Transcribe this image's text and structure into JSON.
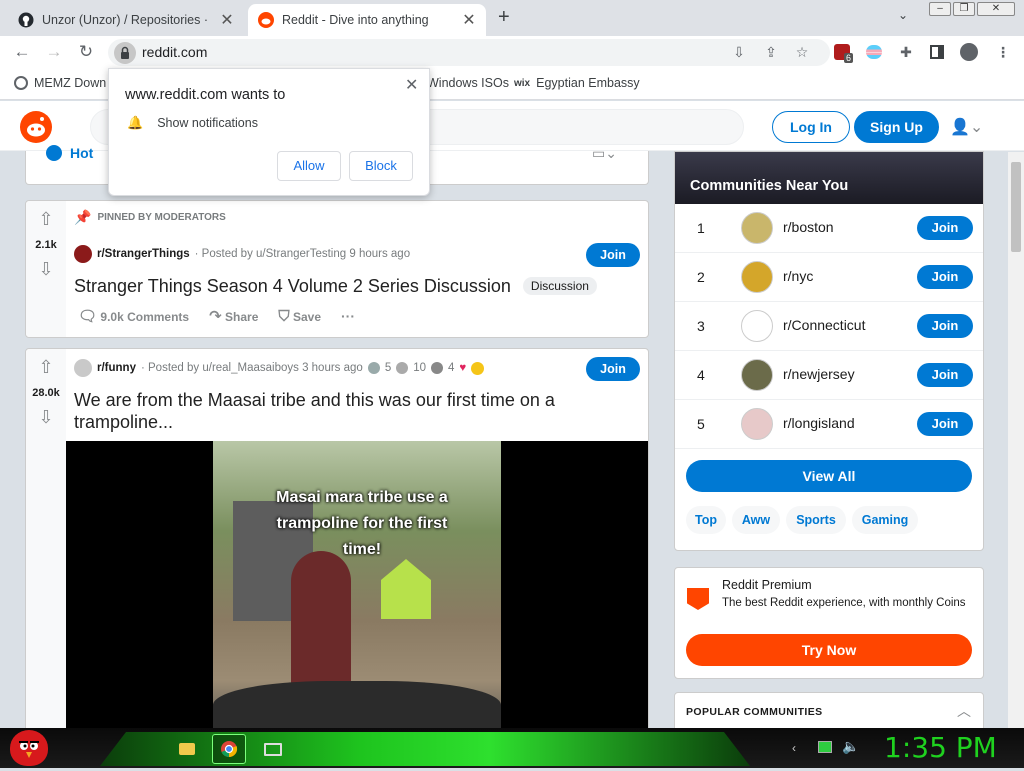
{
  "browser": {
    "tabs": [
      {
        "title": "Unzor (Unzor) / Repositories · GitHub",
        "active": false
      },
      {
        "title": "Reddit - Dive into anything",
        "active": true
      }
    ],
    "new_tab_label": "+",
    "url": "reddit.com",
    "extension_badge": "6",
    "bookmarks": [
      {
        "label": "MEMZ Down"
      },
      {
        "label": "Windows ISOs"
      },
      {
        "label": "Egyptian Embassy"
      }
    ]
  },
  "permission_popup": {
    "title": "www.reddit.com wants to",
    "item": "Show notifications",
    "allow": "Allow",
    "block": "Block"
  },
  "reddit": {
    "login": "Log In",
    "signup": "Sign Up",
    "sort_label": "Hot",
    "posts": [
      {
        "pinned_label": "PINNED BY MODERATORS",
        "score": "2.1k",
        "subreddit": "r/StrangerThings",
        "posted_by": "· Posted by u/StrangerTesting 9 hours ago",
        "title": "Stranger Things Season 4 Volume 2 Series Discussion",
        "flair": "Discussion",
        "join": "Join",
        "comments": "9.0k Comments",
        "share": "Share",
        "save": "Save",
        "more": "···"
      },
      {
        "score": "28.0k",
        "subreddit": "r/funny",
        "posted_by": "· Posted by u/real_Maasaiboys 3 hours ago",
        "award_counts": [
          "5",
          "10",
          "4"
        ],
        "title": "We are from the Maasai tribe and this was our first time on a trampoline...",
        "join": "Join",
        "video_caption": "Masai mara tribe use a trampoline for the first time!"
      }
    ],
    "communities": {
      "header": "Communities Near You",
      "items": [
        {
          "rank": "1",
          "name": "r/boston",
          "join": "Join"
        },
        {
          "rank": "2",
          "name": "r/nyc",
          "join": "Join"
        },
        {
          "rank": "3",
          "name": "r/Connecticut",
          "join": "Join"
        },
        {
          "rank": "4",
          "name": "r/newjersey",
          "join": "Join"
        },
        {
          "rank": "5",
          "name": "r/longisland",
          "join": "Join"
        }
      ],
      "view_all": "View All",
      "tags": [
        "Top",
        "Aww",
        "Sports",
        "Gaming"
      ]
    },
    "premium": {
      "title": "Reddit Premium",
      "desc": "The best Reddit experience, with monthly Coins",
      "button": "Try Now"
    },
    "popular_header": "POPULAR COMMUNITIES"
  },
  "taskbar": {
    "clock": "1:35 PM"
  },
  "colors": {
    "reddit_blue": "#0079d3",
    "reddit_orange": "#ff4500",
    "clock_green": "#1fd21f"
  }
}
